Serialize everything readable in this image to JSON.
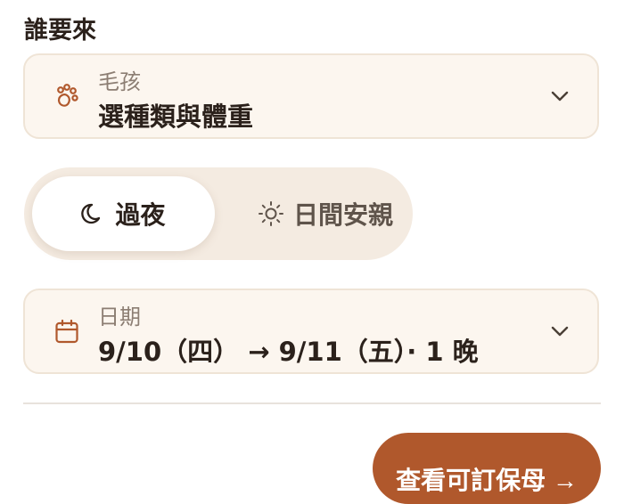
{
  "who": {
    "section_title": "誰要來"
  },
  "pet": {
    "label": "毛孩",
    "value": "選種類與體重",
    "icon": "paw-icon"
  },
  "mode": {
    "options": [
      {
        "label": "過夜",
        "icon": "moon-icon",
        "selected": true
      },
      {
        "label": "日間安親",
        "icon": "sun-icon",
        "selected": false
      }
    ]
  },
  "dates": {
    "label": "日期",
    "value": "9/10（四） → 9/11（五）· 1 晚",
    "icon": "calendar-icon"
  },
  "cta": {
    "label": "查看可訂保母 →"
  },
  "colors": {
    "accent": "#b0582c",
    "field_bg": "#fcf6ef",
    "toggle_bg": "#f4ebe1"
  }
}
